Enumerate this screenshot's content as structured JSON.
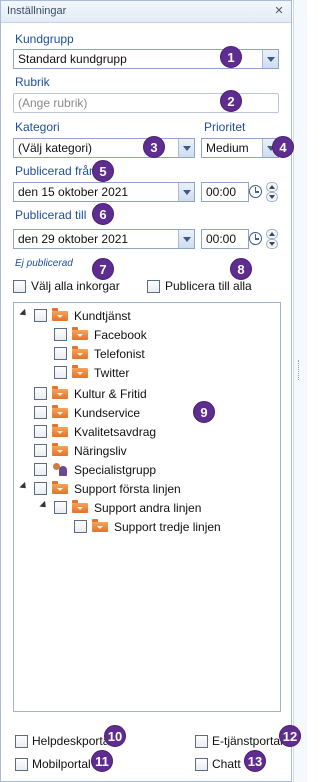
{
  "panel": {
    "title": "Inställningar",
    "pin_icon": "pin-icon"
  },
  "kundgrupp": {
    "label": "Kundgrupp",
    "value": "Standard kundgrupp"
  },
  "rubrik": {
    "label": "Rubrik",
    "placeholder": "(Ange rubrik)"
  },
  "kategori": {
    "label": "Kategori",
    "value": "(Välj kategori)"
  },
  "prioritet": {
    "label": "Prioritet",
    "value": "Medium"
  },
  "publicerad_fran": {
    "label": "Publicerad från",
    "date": "den 15 oktober 2021",
    "time": "00:00"
  },
  "publicerad_till": {
    "label": "Publicerad till",
    "date": "den 29 oktober 2021",
    "time": "00:00"
  },
  "status": "Ej publicerad",
  "checks": {
    "valj_alla": "Välj alla inkorgar",
    "publicera_alla": "Publicera till alla"
  },
  "tree": [
    {
      "label": "Kundtjänst",
      "level": 0,
      "expanded": true,
      "icon": "folder-icon"
    },
    {
      "label": "Facebook",
      "level": 1,
      "icon": "folder-icon"
    },
    {
      "label": "Telefonist",
      "level": 1,
      "icon": "folder-icon"
    },
    {
      "label": "Twitter",
      "level": 1,
      "icon": "folder-icon"
    },
    {
      "label": "Kultur & Fritid",
      "level": 0,
      "icon": "folder-icon"
    },
    {
      "label": "Kundservice",
      "level": 0,
      "icon": "folder-icon"
    },
    {
      "label": "Kvalitetsavdrag",
      "level": 0,
      "icon": "folder-icon"
    },
    {
      "label": "Näringsliv",
      "level": 0,
      "icon": "folder-icon"
    },
    {
      "label": "Specialistgrupp",
      "level": 0,
      "icon": "group-icon"
    },
    {
      "label": "Support första linjen",
      "level": 0,
      "expanded": true,
      "icon": "folder-icon"
    },
    {
      "label": "Support andra linjen",
      "level": 1,
      "expanded": true,
      "icon": "folder-icon"
    },
    {
      "label": "Support tredje linjen",
      "level": 2,
      "icon": "folder-icon"
    }
  ],
  "portals": {
    "helpdesk": "Helpdeskportal",
    "mobil": "Mobilportal",
    "etjanst": "E-tjänstportal",
    "chatt": "Chatt"
  },
  "badges": [
    "1",
    "2",
    "3",
    "4",
    "5",
    "6",
    "7",
    "8",
    "9",
    "10",
    "11",
    "12",
    "13"
  ],
  "colors": {
    "label_blue": "#1f4e9c",
    "badge_purple": "#5f2c8f",
    "folder_orange": "#e4722a"
  }
}
